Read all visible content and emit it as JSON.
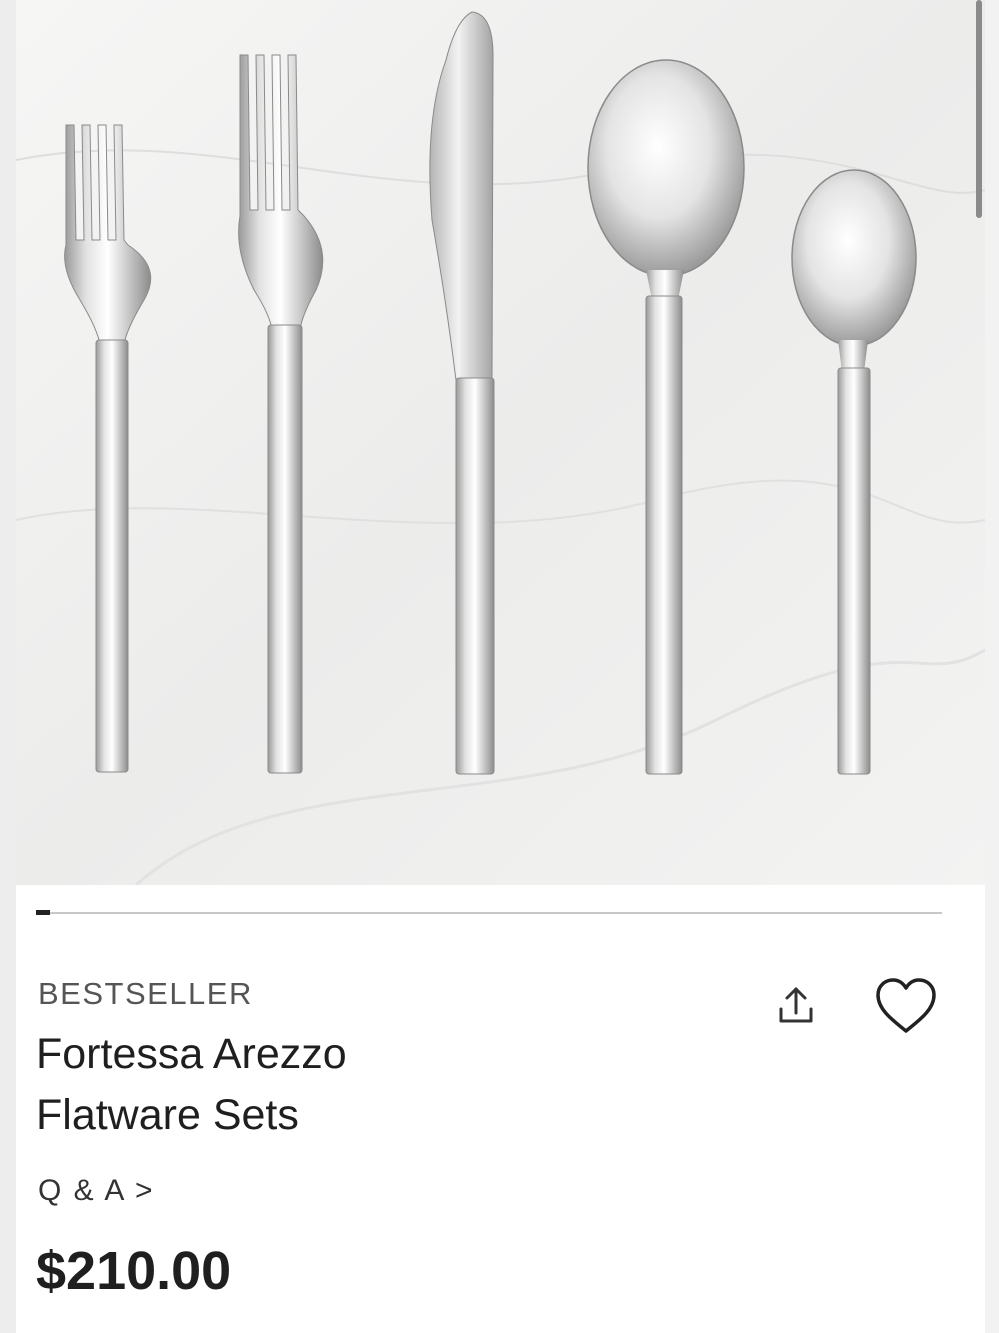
{
  "product": {
    "image_alt": "Fortessa Arezzo Flatware Sets",
    "badge": "BESTSELLER",
    "title": "Fortessa Arezzo Flatware Sets",
    "qa_link": "Q & A >",
    "price": "$210.00"
  },
  "carousel": {
    "current_slide": 1
  },
  "icons": {
    "share": "share-icon",
    "favorite": "heart-icon"
  },
  "colors": {
    "text": "#1f1f1f",
    "muted": "#555555",
    "background": "#ffffff"
  }
}
